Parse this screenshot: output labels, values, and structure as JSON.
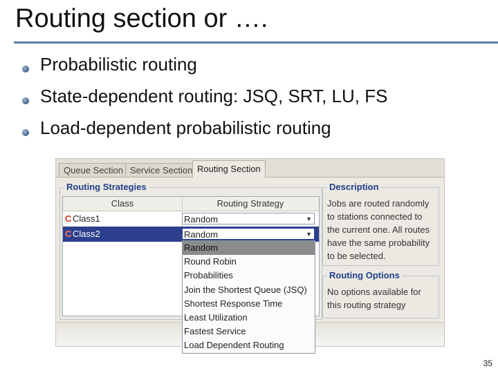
{
  "slide": {
    "title": "Routing section or ….",
    "bullets": [
      "Probabilistic routing",
      "State-dependent routing: JSQ, SRT, LU, FS",
      "Load-dependent probabilistic routing"
    ],
    "page_number": "35"
  },
  "window": {
    "tabs": [
      "Queue Section",
      "Service Section",
      "Routing Section"
    ],
    "active_tab": "Routing Section",
    "routing_strategies": {
      "title": "Routing Strategies",
      "columns": [
        "Class",
        "Routing Strategy"
      ],
      "rows": [
        {
          "class": "Class1",
          "strategy": "Random",
          "selected": false
        },
        {
          "class": "Class2",
          "strategy": "Random",
          "selected": true
        }
      ]
    },
    "dropdown_options": [
      "Random",
      "Round Robin",
      "Probabilities",
      "Join the Shortest Queue (JSQ)",
      "Shortest Response Time",
      "Least Utilization",
      "Fastest Service",
      "Load Dependent Routing"
    ],
    "dropdown_highlighted": "Random",
    "description": {
      "title": "Description",
      "text": "Jobs are routed randomly to stations connected to the current one. All routes have the same probability to be selected."
    },
    "routing_options": {
      "title": "Routing Options",
      "text": "No options available for this routing strategy"
    }
  },
  "icons": {
    "class_icon": "class-c-icon",
    "dropdown_arrow": "chevron-down-icon",
    "bullet": "bullet-dot-icon"
  },
  "colors": {
    "title_rule": "#5b7fa6",
    "group_title": "#1e3f8a",
    "selected_row": "#2c3f8c",
    "highlight_item": "#8b8b8b"
  }
}
